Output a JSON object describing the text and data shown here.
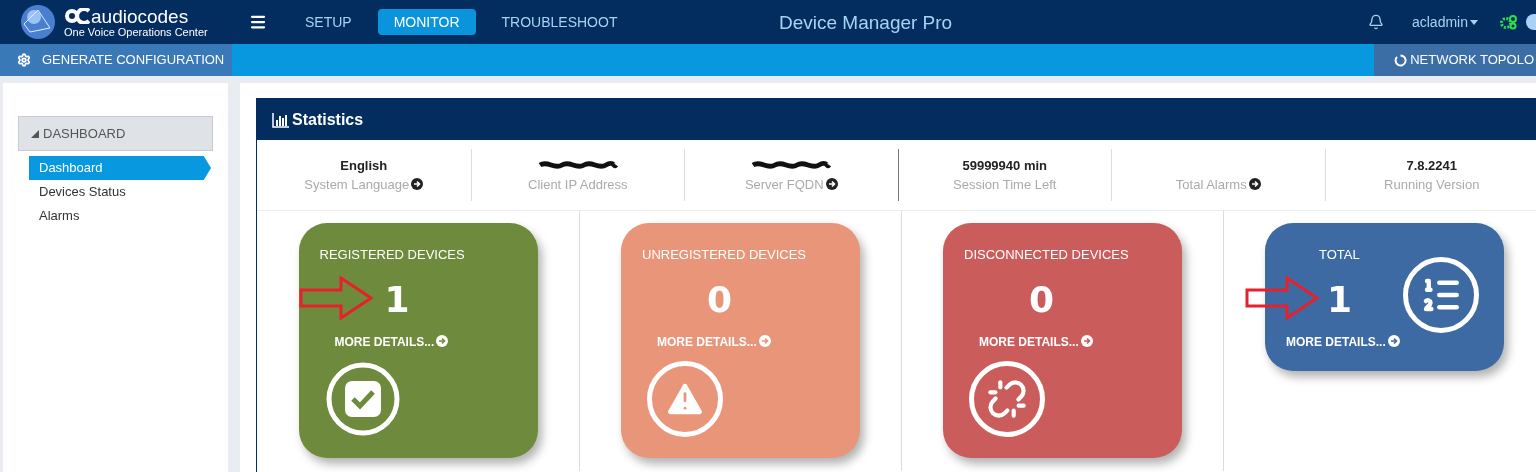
{
  "header": {
    "brand": "audiocodes",
    "subtitle": "One Voice Operations Center",
    "nav": [
      {
        "label": "SETUP",
        "selected": false
      },
      {
        "label": "MONITOR",
        "selected": true
      },
      {
        "label": "TROUBLESHOOT",
        "selected": false
      }
    ],
    "title": "Device Manager Pro",
    "user": "acladmin"
  },
  "toolbar": {
    "left_button": "GENERATE CONFIGURATION",
    "right_button": "NETWORK TOPOLO"
  },
  "sidebar": {
    "group": {
      "label": "DASHBOARD",
      "expanded": true
    },
    "items": [
      {
        "label": "Dashboard",
        "selected": true
      },
      {
        "label": "Devices Status",
        "selected": false
      },
      {
        "label": "Alarms",
        "selected": false
      }
    ]
  },
  "statistics": {
    "title": "Statistics",
    "items": [
      {
        "value": "English",
        "label": "System Language",
        "link": true,
        "redacted": false
      },
      {
        "label": "Client IP Address",
        "link": false,
        "redacted": true
      },
      {
        "label": "Server FQDN",
        "link": true,
        "redacted": true
      },
      {
        "value": "59999940 min",
        "label": "Session Time Left",
        "link": false,
        "redacted": false
      },
      {
        "label": "Total Alarms",
        "link": true,
        "redacted": false
      },
      {
        "value": "7.8.2241",
        "label": "Running Version",
        "link": false,
        "redacted": false
      }
    ]
  },
  "cards": [
    {
      "kind": "registered",
      "title": "REGISTERED DEVICES",
      "count": "1",
      "link": "MORE DETAILS...",
      "color": "#6e8a3c",
      "annotated": true
    },
    {
      "kind": "unregistered",
      "title": "UNREGISTERED DEVICES",
      "count": "0",
      "link": "MORE DETAILS...",
      "color": "#e8957a",
      "annotated": false
    },
    {
      "kind": "disconnected",
      "title": "DISCONNECTED DEVICES",
      "count": "0",
      "link": "MORE DETAILS...",
      "color": "#cb5c5c",
      "annotated": false
    },
    {
      "kind": "total",
      "title": "TOTAL",
      "count": "1",
      "link": "MORE DETAILS...",
      "color": "#3d6aa2",
      "annotated": true
    }
  ]
}
